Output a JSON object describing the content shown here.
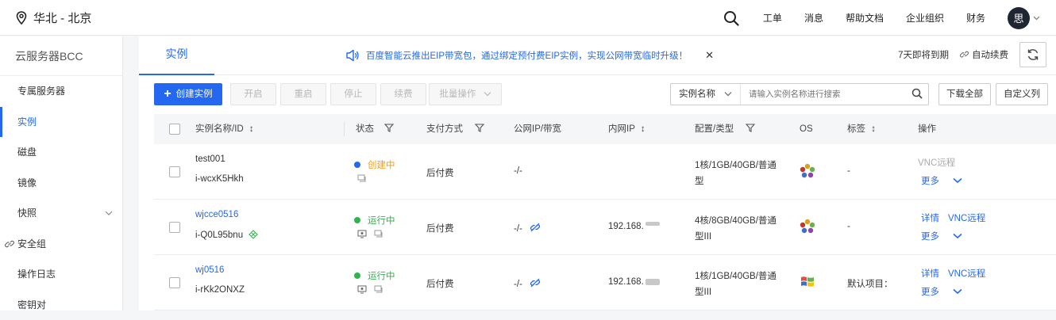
{
  "header": {
    "region": "华北 - 北京",
    "nav": [
      "工单",
      "消息",
      "帮助文档",
      "企业组织",
      "财务"
    ],
    "avatar_initial": "思"
  },
  "sidebar": {
    "title": "云服务器BCC",
    "items": [
      {
        "label": "专属服务器"
      },
      {
        "label": "实例",
        "active": true
      },
      {
        "label": "磁盘"
      },
      {
        "label": "镜像"
      },
      {
        "label": "快照",
        "expandable": true
      },
      {
        "label": "安全组",
        "link_icon": true
      },
      {
        "label": "操作日志"
      },
      {
        "label": "密钥对"
      }
    ]
  },
  "main": {
    "tab": "实例",
    "notice": "百度智能云推出EIP带宽包，通过绑定预付费EIP实例，实现公网带宽临时升级！",
    "expiring": "7天即将到期",
    "auto_renew": "自动续费"
  },
  "toolbar": {
    "create": "创建实例",
    "start": "开启",
    "restart": "重启",
    "stop": "停止",
    "renew": "续费",
    "batch": "批量操作",
    "search_field": "实例名称",
    "search_placeholder": "请输入实例名称进行搜索",
    "download_all": "下载全部",
    "custom_columns": "自定义列"
  },
  "table": {
    "headers": {
      "name": "实例名称/ID",
      "status": "状态",
      "payment": "支付方式",
      "public_ip": "公网IP/带宽",
      "private_ip": "内网IP",
      "config": "配置/类型",
      "os": "OS",
      "tags": "标签",
      "actions": "操作"
    },
    "rows": [
      {
        "name": "test001",
        "id": "i-wcxK5Hkh",
        "name_is_link": false,
        "status": "创建中",
        "status_kind": "creating",
        "payment": "后付费",
        "public_ip": "-/-",
        "private_ip": "",
        "config_line1": "1核/1GB/40GB/普通",
        "config_line2": "型",
        "os": "linux",
        "tags": "-",
        "action1": "VNC远程",
        "more": "更多"
      },
      {
        "name": "wjcce0516",
        "id": "i-Q0L95bnu",
        "name_is_link": true,
        "status": "运行中",
        "status_kind": "running",
        "payment": "后付费",
        "public_ip": "-/-",
        "private_ip": "192.168.",
        "config_line1": "4核/8GB/40GB/普通",
        "config_line2": "型III",
        "os": "linux",
        "tags": "-",
        "detail": "详情",
        "action1": "VNC远程",
        "more": "更多"
      },
      {
        "name": "wj0516",
        "id": "i-rKk2ONXZ",
        "name_is_link": true,
        "status": "运行中",
        "status_kind": "running",
        "payment": "后付费",
        "public_ip": "-/-",
        "private_ip": "192.168.",
        "config_line1": "1核/1GB/40GB/普通",
        "config_line2": "型III",
        "os": "windows",
        "tags": "默认项目：",
        "detail": "详情",
        "action1": "VNC远程",
        "more": "更多"
      }
    ]
  },
  "colors": {
    "accent": "#2468f2",
    "running": "#2eb44a",
    "creating": "#f39c12"
  }
}
